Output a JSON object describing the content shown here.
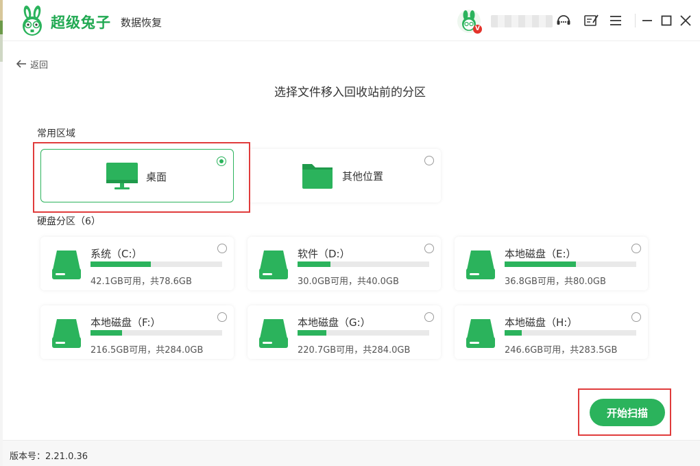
{
  "app": {
    "brand": "超级兔子",
    "subtitle": "数据恢复",
    "version_label": "版本号：2.21.0.36",
    "avatar_badge": "V"
  },
  "nav": {
    "back_label": "返回"
  },
  "page": {
    "title": "选择文件移入回收站前的分区"
  },
  "common": {
    "label": "常用区域",
    "items": [
      {
        "label": "桌面",
        "icon": "monitor-icon",
        "selected": true
      },
      {
        "label": "其他位置",
        "icon": "folder-icon",
        "selected": false
      }
    ]
  },
  "disks": {
    "label": "硬盘分区（6）",
    "items": [
      {
        "name": "系统（C:）",
        "space": "42.1GB可用，共78.6GB",
        "used_fraction": 0.46
      },
      {
        "name": "软件（D:）",
        "space": "30.0GB可用，共40.0GB",
        "used_fraction": 0.25
      },
      {
        "name": "本地磁盘（E:）",
        "space": "36.8GB可用，共80.0GB",
        "used_fraction": 0.54
      },
      {
        "name": "本地磁盘（F:）",
        "space": "216.5GB可用，共284.0GB",
        "used_fraction": 0.24
      },
      {
        "name": "本地磁盘（G:）",
        "space": "220.7GB可用，共284.0GB",
        "used_fraction": 0.22
      },
      {
        "name": "本地磁盘（H:）",
        "space": "246.6GB可用，共283.5GB",
        "used_fraction": 0.13
      }
    ]
  },
  "actions": {
    "scan_label": "开始扫描"
  },
  "colors": {
    "accent": "#2bb35c",
    "highlight": "#e03b3b"
  },
  "titlebar_icons": [
    "customer-service-icon",
    "feedback-icon",
    "menu-icon",
    "minimize-icon",
    "maximize-icon",
    "close-icon"
  ]
}
